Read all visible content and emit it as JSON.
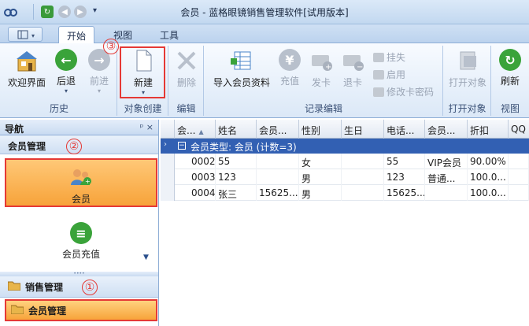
{
  "window": {
    "title": "会员 - 蓝格眼镜销售管理软件[试用版本]"
  },
  "tabs": [
    {
      "label": "开始"
    },
    {
      "label": "视图"
    },
    {
      "label": "工具"
    }
  ],
  "ribbon": {
    "groups": {
      "history": "历史",
      "object_create": "对象创建",
      "edit": "编辑",
      "records_edit": "记录编辑",
      "open_object": "打开对象",
      "view": "视图"
    },
    "buttons": {
      "welcome": "欢迎界面",
      "back": "后退",
      "forward": "前进",
      "new": "新建",
      "delete": "删除",
      "import_members": "导入会员资料",
      "recharge": "充值",
      "issue_card": "发卡",
      "return_card": "退卡",
      "suspend": "挂失",
      "enable": "启用",
      "change_password": "修改卡密码",
      "open_object": "打开对象",
      "refresh": "刷新"
    }
  },
  "annotations": {
    "a1": "①",
    "a2": "②",
    "a3": "③"
  },
  "nav": {
    "title": "导航",
    "controls": "ᵖ ×",
    "section": "会员管理",
    "items": [
      {
        "label": "会员"
      },
      {
        "label": "会员充值"
      }
    ],
    "groups": [
      {
        "label": "销售管理"
      },
      {
        "label": "会员管理"
      }
    ]
  },
  "grid": {
    "columns": [
      "会...",
      "姓名",
      "会员...",
      "性别",
      "生日",
      "电话...",
      "会员...",
      "折扣",
      "QQ"
    ],
    "group_row": "会员类型: 会员 (计数=3)",
    "rows": [
      [
        "0002",
        "55",
        "",
        "女",
        "",
        "55",
        "VIP会员",
        "90.00%",
        ""
      ],
      [
        "0003",
        "123",
        "",
        "男",
        "",
        "123",
        "普通...",
        "100.0...",
        ""
      ],
      [
        "0004",
        "张三",
        "15625...",
        "男",
        "",
        "15625...",
        "",
        "100.0...",
        ""
      ]
    ]
  },
  "colors": {
    "accent": "#3260b3",
    "highlight": "#f7a33a",
    "annotation": "#e53935"
  }
}
